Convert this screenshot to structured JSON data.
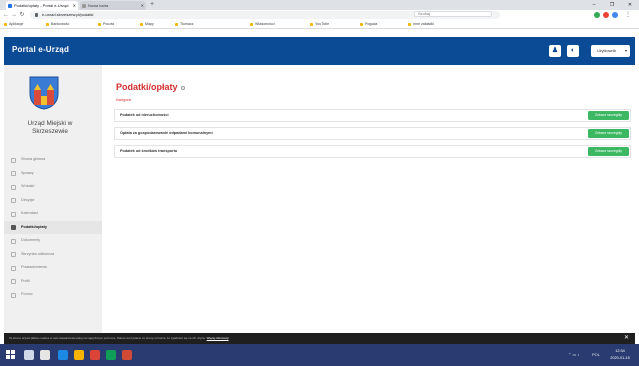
{
  "browser": {
    "tabs": [
      {
        "title": "Podatki/opłaty - Portal e-Urząd",
        "active": true
      },
      {
        "title": "Nowa karta",
        "active": false
      }
    ],
    "address": "e-urzad.skrzeszew.pl/podatki",
    "search_placeholder": "Szukaj",
    "bookmarks": [
      "Aplikacje",
      "Bankowość",
      "Poczta",
      "Mapy",
      "Tłumacz",
      "Wiadomości",
      "YouTube",
      "Pogoda",
      "Inne zakładki"
    ]
  },
  "header": {
    "brand": "Portal e-Urząd",
    "user_label": "Użytkownik"
  },
  "sidebar": {
    "office_name": "Urząd Miejski w Skrzeszewie",
    "items": [
      {
        "label": "Strona główna",
        "active": false
      },
      {
        "label": "Sprawy",
        "active": false
      },
      {
        "label": "Wnioski",
        "active": false
      },
      {
        "label": "Decyzje",
        "active": false
      },
      {
        "label": "Kalendarz",
        "active": false
      },
      {
        "label": "Podatki/opłaty",
        "active": true
      },
      {
        "label": "Dokumenty",
        "active": false
      },
      {
        "label": "Skrzynka odbiorcza",
        "active": false
      },
      {
        "label": "Powiadomienia",
        "active": false
      },
      {
        "label": "Profil",
        "active": false
      },
      {
        "label": "Pomoc",
        "active": false
      }
    ]
  },
  "main": {
    "title": "Podatki/opłaty",
    "category": "Kategorie",
    "button_label": "Zobacz szczegóły",
    "rows": [
      {
        "label": "Podatek od nieruchomości"
      },
      {
        "label": "Opłata za gospodarowanie odpadami komunalnymi"
      },
      {
        "label": "Podatek od środków transportu"
      }
    ]
  },
  "cookie": {
    "text": "Ta strona używa plików cookies w celu świadczenia usług na najwyższym poziomie. Dalsze korzystanie ze strony oznacza, że zgadzasz się na ich użycie.",
    "link": "Więcej informacji",
    "close": "✕"
  },
  "taskbar": {
    "time": "12:34",
    "date": "2020-01-15",
    "lang": "POL"
  },
  "colors": {
    "header_bg": "#0b4a94",
    "accent_red": "#d32f2f",
    "button_green": "#3cb863",
    "taskbar_bg": "#2a3b72"
  }
}
